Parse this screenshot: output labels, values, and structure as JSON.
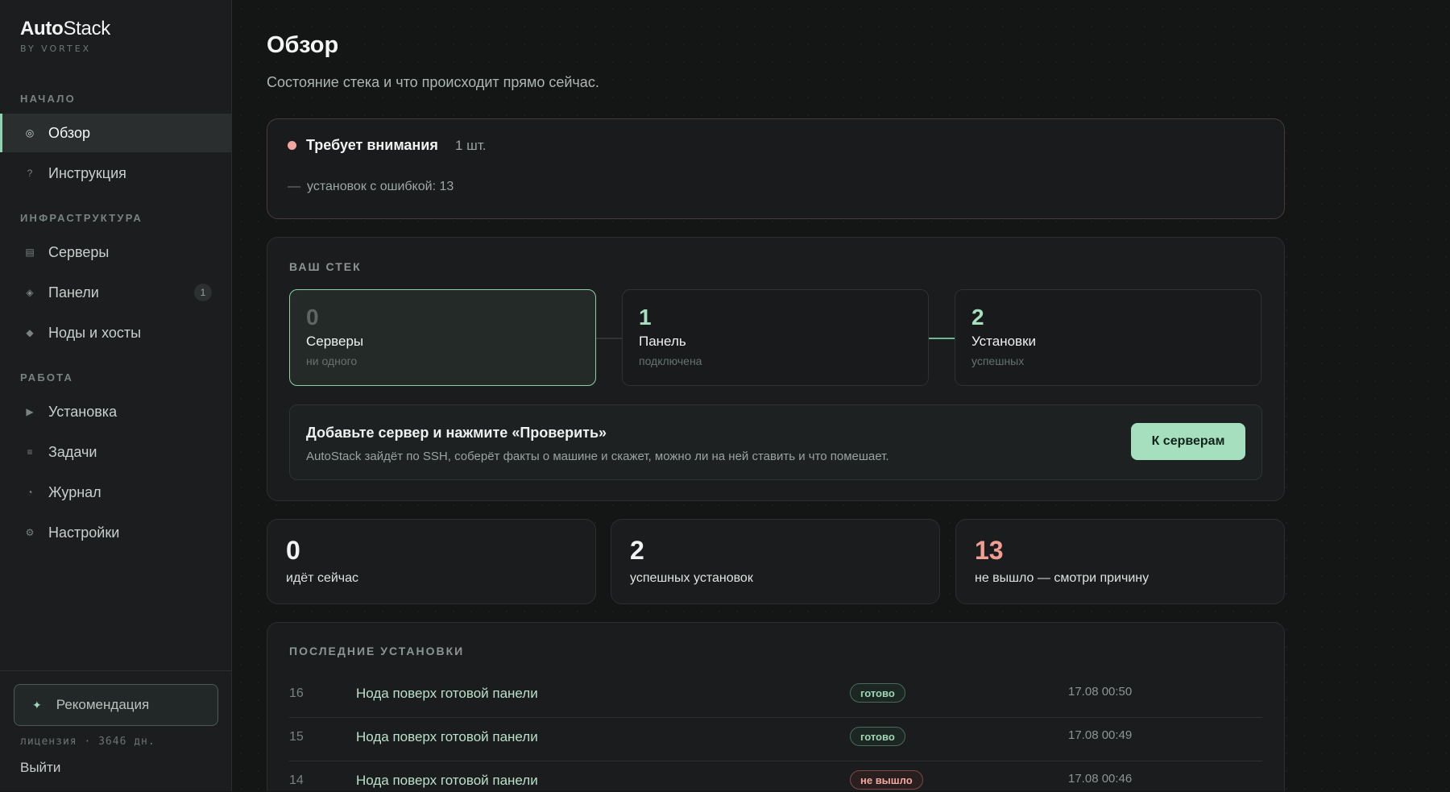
{
  "logo": {
    "brand_bold": "Auto",
    "brand_rest": "Stack",
    "sub": "BY VORTEX"
  },
  "sidebar": {
    "sections": [
      {
        "title": "НАЧАЛО"
      },
      {
        "title": "ИНФРАСТРУКТУРА"
      },
      {
        "title": "РАБОТА"
      }
    ],
    "items": [
      {
        "label": "Обзор",
        "icon": "target-icon",
        "glyph": "◎",
        "active": true
      },
      {
        "label": "Инструкция",
        "icon": "help-icon",
        "glyph": "?"
      },
      {
        "label": "Серверы",
        "icon": "server-icon",
        "glyph": "▤"
      },
      {
        "label": "Панели",
        "icon": "panel-icon",
        "glyph": "◈",
        "badge": "1"
      },
      {
        "label": "Ноды и хосты",
        "icon": "node-icon",
        "glyph": "◆"
      },
      {
        "label": "Установка",
        "icon": "play-icon",
        "glyph": "▶"
      },
      {
        "label": "Задачи",
        "icon": "list-icon",
        "glyph": "≡"
      },
      {
        "label": "Журнал",
        "icon": "clock-icon",
        "glyph": "◔"
      },
      {
        "label": "Настройки",
        "icon": "gear-icon",
        "glyph": "⚙"
      }
    ],
    "recommend": {
      "label": "Рекомендация",
      "glyph": "✦"
    },
    "license": "лицензия · 3646 дн.",
    "logout": "Выйти"
  },
  "header": {
    "title": "Обзор",
    "subtitle": "Состояние стека и что происходит прямо сейчас."
  },
  "alert": {
    "title": "Требует внимания",
    "count": "1 шт.",
    "dash": "—",
    "line": "установок с ошибкой: 13"
  },
  "stack": {
    "label": "ВАШ СТЕК",
    "boxes": [
      {
        "num": "0",
        "label": "Серверы",
        "hint": "ни одного"
      },
      {
        "num": "1",
        "label": "Панель",
        "hint": "подключена"
      },
      {
        "num": "2",
        "label": "Установки",
        "hint": "успешных"
      }
    ],
    "cta": {
      "title": "Добавьте сервер и нажмите «Проверить»",
      "desc": "AutoStack зайдёт по SSH, соберёт факты о машине и скажет, можно ли на ней ставить и что помешает.",
      "button": "К серверам"
    }
  },
  "stats": [
    {
      "num": "0",
      "label": "идёт сейчас"
    },
    {
      "num": "2",
      "label": "успешных установок"
    },
    {
      "num": "13",
      "label": "не вышло — смотри причину"
    }
  ],
  "recent": {
    "label": "ПОСЛЕДНИЕ УСТАНОВКИ",
    "rows": [
      {
        "id": "16",
        "name": "Нода поверх готовой панели",
        "status": "готово",
        "time": "17.08 00:50"
      },
      {
        "id": "15",
        "name": "Нода поверх готовой панели",
        "status": "готово",
        "time": "17.08 00:49"
      },
      {
        "id": "14",
        "name": "Нода поверх готовой панели",
        "status": "не вышло",
        "time": "17.08 00:46"
      }
    ]
  },
  "colors": {
    "accent": "#a6dfbe",
    "danger": "#f29e92",
    "bg": "#141616"
  }
}
